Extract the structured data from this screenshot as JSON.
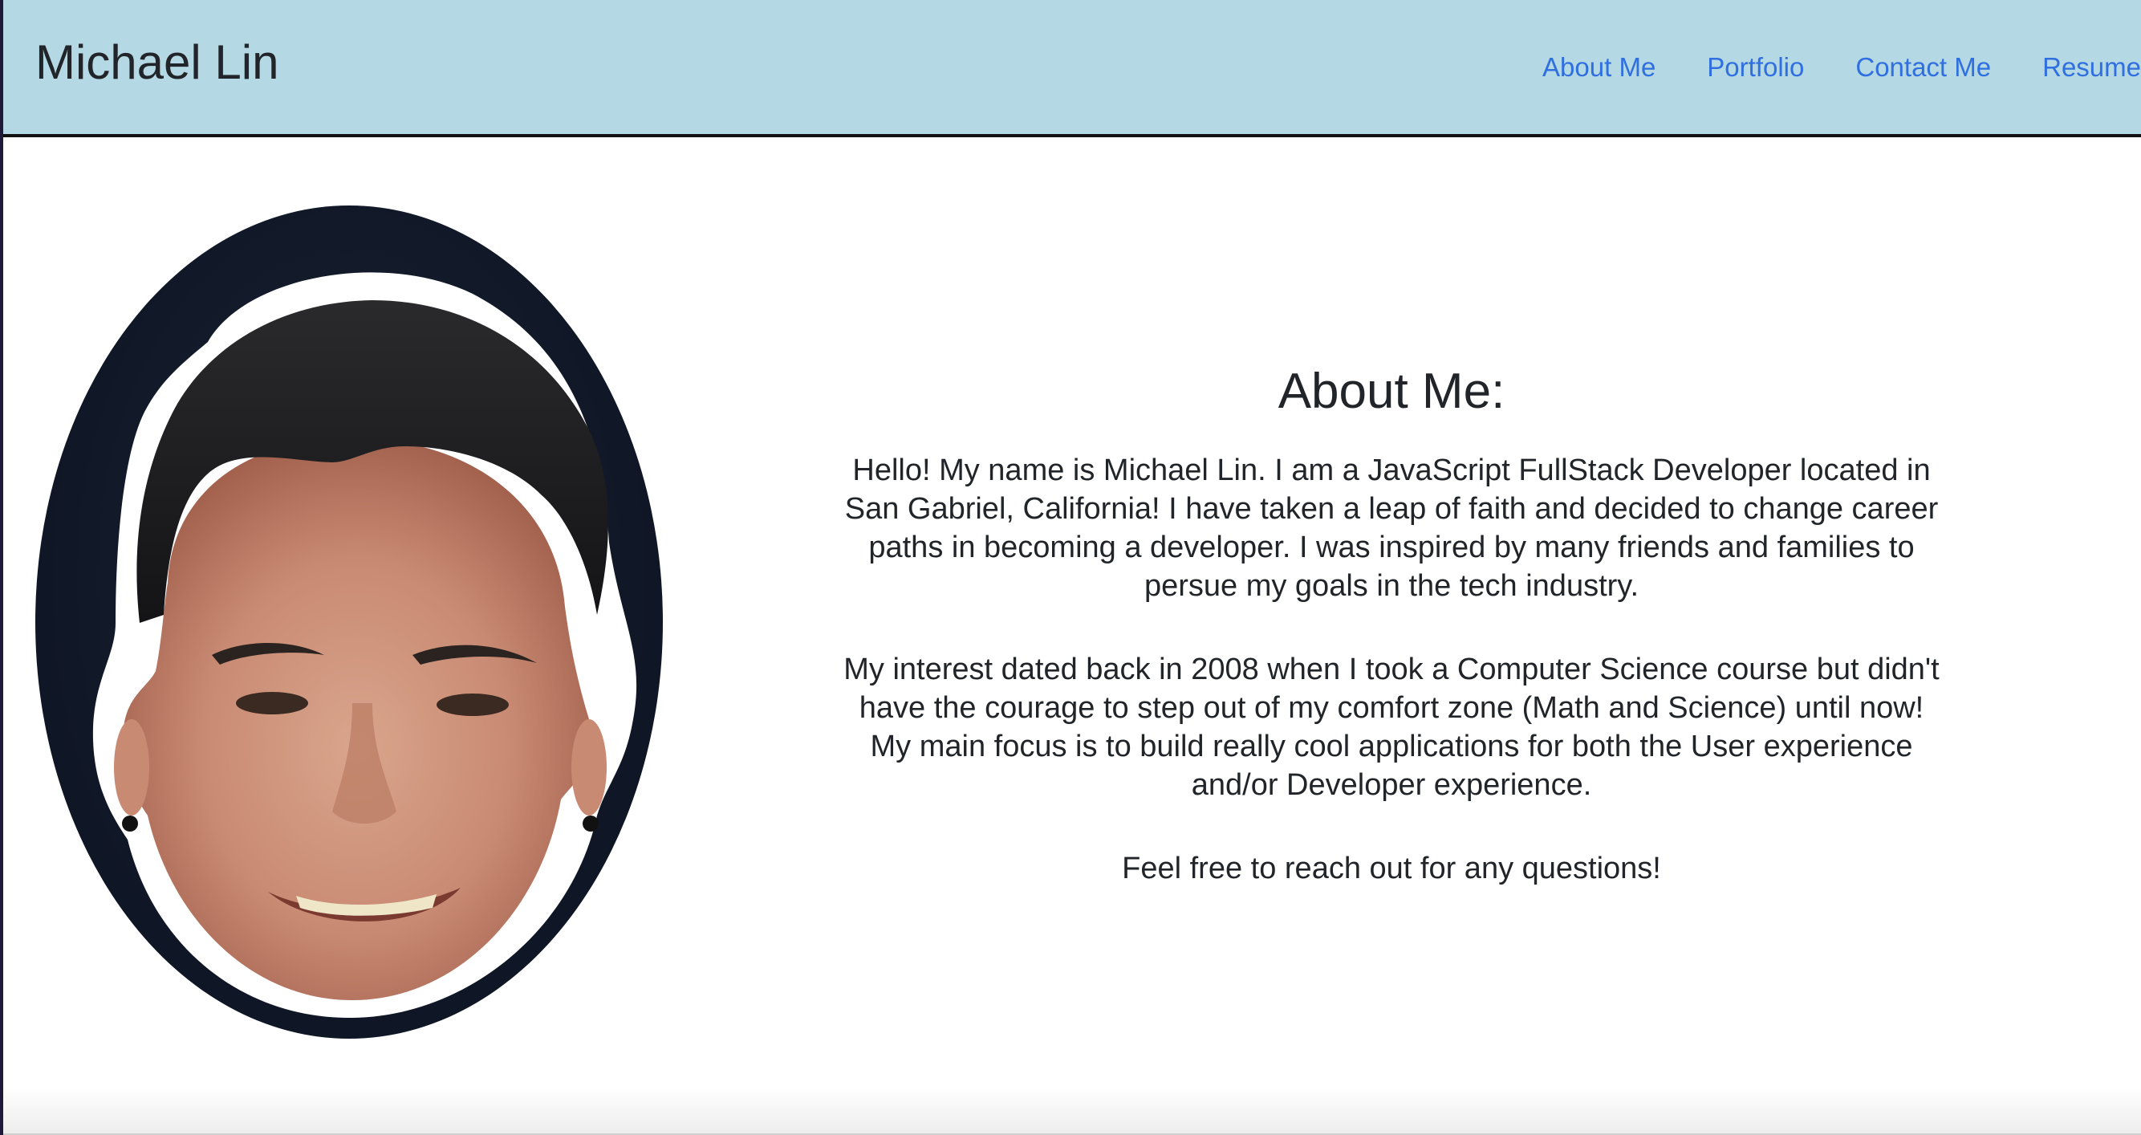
{
  "header": {
    "brand": "Michael Lin",
    "nav": [
      {
        "label": "About Me"
      },
      {
        "label": "Portfolio"
      },
      {
        "label": "Contact Me"
      },
      {
        "label": "Resume"
      }
    ]
  },
  "portrait": {
    "icon": "portrait-photo"
  },
  "about": {
    "heading": "About Me:",
    "paragraphs": [
      "Hello! My name is Michael Lin. I am a JavaScript FullStack Developer located in San Gabriel, California! I have taken a leap of faith and decided to change career paths in becoming a developer. I was inspired by many friends and families to persue my goals in the tech industry.",
      "My interest dated back in 2008 when I took a Computer Science course but didn't have the courage to step out of my comfort zone (Math and Science) until now! My main focus is to build really cool applications for both the User experience and/or Developer experience.",
      "Feel free to reach out for any questions!"
    ]
  },
  "colors": {
    "header_bg": "#b4d8e4",
    "link": "#2f6fe0",
    "text": "#212529"
  }
}
